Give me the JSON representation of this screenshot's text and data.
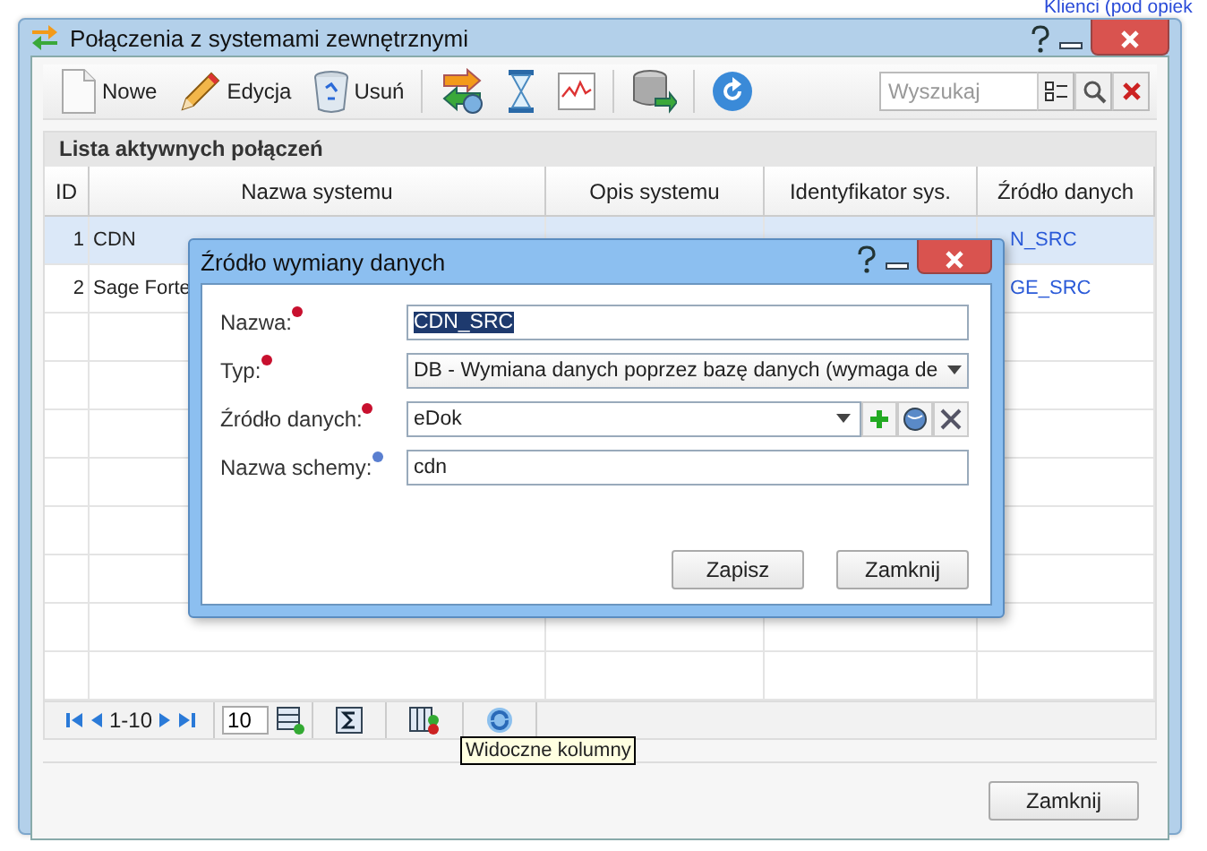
{
  "background_link": "Klienci (pod opiek",
  "window": {
    "title": "Połączenia z systemami zewnętrznymi"
  },
  "toolbar": [
    {
      "kind": "new",
      "label": "Nowe"
    },
    {
      "kind": "edit",
      "label": "Edycja"
    },
    {
      "kind": "delete",
      "label": "Usuń"
    },
    {
      "kind": "sync"
    },
    {
      "kind": "hourglass"
    },
    {
      "kind": "chart"
    },
    {
      "kind": "database"
    },
    {
      "kind": "refresh"
    }
  ],
  "search": {
    "placeholder": "Wyszukaj"
  },
  "grid": {
    "title": "Lista aktywnych połączeń",
    "columns": [
      "ID",
      "Nazwa systemu",
      "Opis systemu",
      "Identyfikator sys.",
      "Źródło danych"
    ],
    "rows": [
      {
        "selected": true,
        "cells": [
          "1",
          "CDN",
          "",
          "",
          "N_SRC"
        ]
      },
      {
        "selected": false,
        "cells": [
          "2",
          "Sage Forte",
          "",
          "",
          "GE_SRC"
        ]
      }
    ]
  },
  "pager": {
    "range": "1-10",
    "page_size": "10"
  },
  "tooltip": "Widoczne kolumny",
  "footer_button": "Zamknij",
  "dialog": {
    "title": "Źródło wymiany danych",
    "fields": [
      {
        "label": "Nazwa:",
        "color": "#c8102e",
        "kind": "text",
        "value": "CDN_SRC",
        "highlighted": true
      },
      {
        "label": "Typ:",
        "color": "#c8102e",
        "kind": "select",
        "value": "DB - Wymiana danych poprzez bazę danych (wymaga de"
      },
      {
        "label": "Źródło danych:",
        "color": "#c8102e",
        "kind": "select_actions",
        "value": "eDok"
      },
      {
        "label": "Nazwa schemy:",
        "color": "#5a7fd0",
        "kind": "text",
        "value": "cdn",
        "highlighted": false
      }
    ],
    "buttons": [
      "Zapisz",
      "Zamknij"
    ]
  }
}
